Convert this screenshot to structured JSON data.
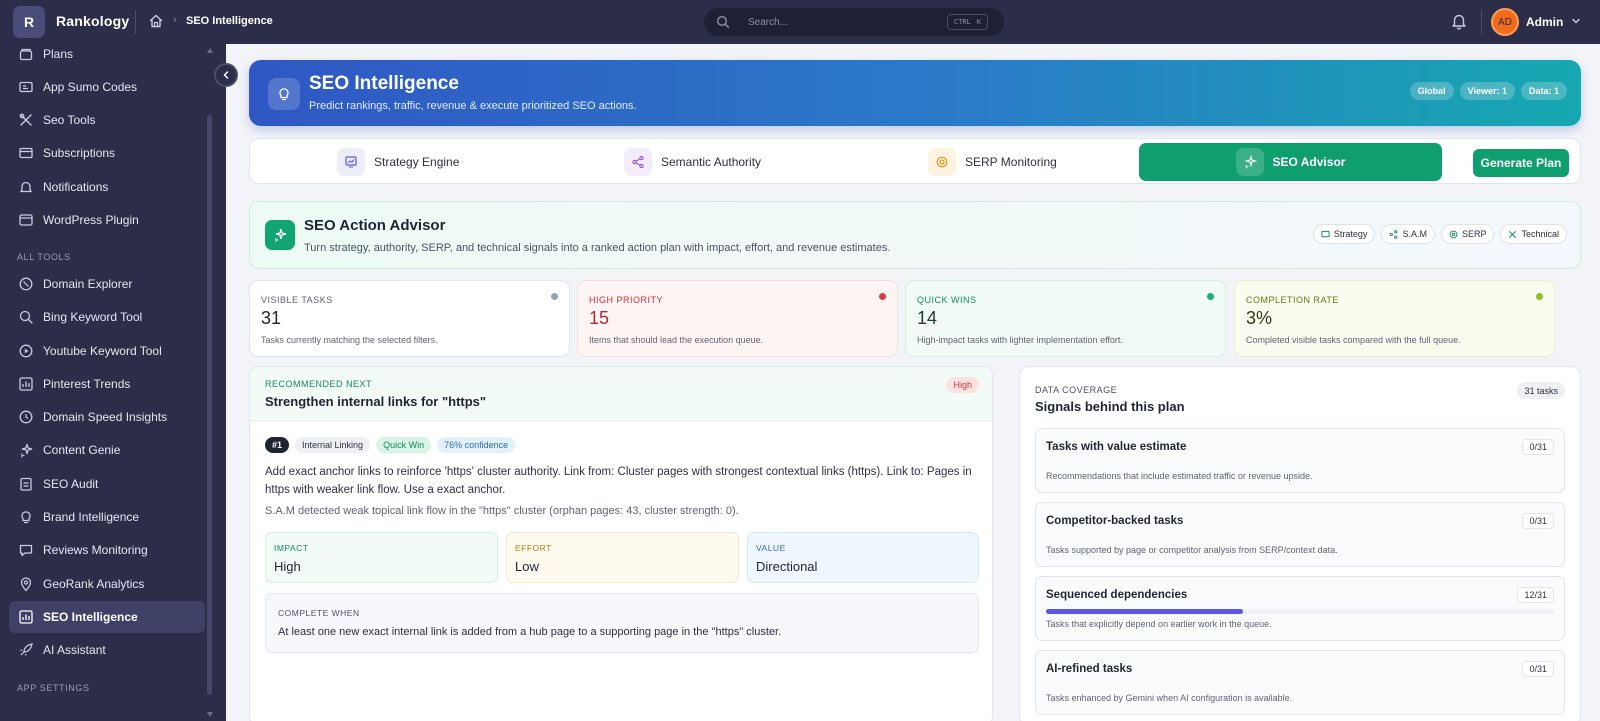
{
  "app": {
    "logo_letter": "R",
    "name": "Rankology"
  },
  "breadcrumb": {
    "current": "SEO Intelligence"
  },
  "search": {
    "placeholder": "Search...",
    "shortcut_ctrl": "CTRL",
    "shortcut_key": "K"
  },
  "user": {
    "initials": "AD",
    "name": "Admin"
  },
  "sidebar": {
    "items_top": [
      {
        "label": "Plans",
        "icon": "plans-icon"
      },
      {
        "label": "App Sumo Codes",
        "icon": "ticket-icon"
      },
      {
        "label": "Seo Tools",
        "icon": "tools-icon"
      },
      {
        "label": "Subscriptions",
        "icon": "card-icon"
      },
      {
        "label": "Notifications",
        "icon": "bell-icon"
      },
      {
        "label": "WordPress Plugin",
        "icon": "plugin-icon"
      }
    ],
    "section_tools": "ALL TOOLS",
    "items_tools": [
      {
        "label": "Domain Explorer",
        "icon": "globe-icon"
      },
      {
        "label": "Bing Keyword Tool",
        "icon": "search-icon"
      },
      {
        "label": "Youtube Keyword Tool",
        "icon": "play-icon"
      },
      {
        "label": "Pinterest Trends",
        "icon": "chart-icon"
      },
      {
        "label": "Domain Speed Insights",
        "icon": "clock-icon"
      },
      {
        "label": "Content Genie",
        "icon": "sparkle-icon"
      },
      {
        "label": "SEO Audit",
        "icon": "audit-icon"
      },
      {
        "label": "Brand Intelligence",
        "icon": "bulb-icon"
      },
      {
        "label": "Reviews Monitoring",
        "icon": "chat-icon"
      },
      {
        "label": "GeoRank Analytics",
        "icon": "pin-icon"
      },
      {
        "label": "SEO Intelligence",
        "icon": "chart-icon",
        "active": true
      },
      {
        "label": "AI Assistant",
        "icon": "rocket-icon"
      }
    ],
    "section_settings": "APP SETTINGS"
  },
  "hero": {
    "title": "SEO Intelligence",
    "subtitle": "Predict rankings, traffic, revenue & execute prioritized SEO actions.",
    "pills": [
      "Global",
      "Viewer: 1",
      "Data: 1"
    ]
  },
  "tabs": [
    {
      "label": "Strategy Engine"
    },
    {
      "label": "Semantic Authority"
    },
    {
      "label": "SERP Monitoring"
    },
    {
      "label": "SEO Advisor",
      "active": true
    }
  ],
  "generate_button": "Generate Plan",
  "advisor": {
    "title": "SEO Action Advisor",
    "subtitle": "Turn strategy, authority, SERP, and technical signals into a ranked action plan with impact, effort, and revenue estimates.",
    "chips": [
      "Strategy",
      "S.A.M",
      "SERP",
      "Technical"
    ]
  },
  "stats": [
    {
      "label": "VISIBLE TASKS",
      "value": "31",
      "desc": "Tasks currently matching the selected filters.",
      "color": "#5a6172",
      "dot": "#9aa0ad"
    },
    {
      "label": "HIGH PRIORITY",
      "value": "15",
      "desc": "Items that should lead the execution queue.",
      "color": "#c0303a",
      "dot": "#e03b3b"
    },
    {
      "label": "QUICK WINS",
      "value": "14",
      "desc": "High-impact tasks with lighter implementation effort.",
      "color": "#13895f",
      "dot": "#16b27a"
    },
    {
      "label": "COMPLETION RATE",
      "value": "3%",
      "desc": "Completed visible tasks compared with the full queue.",
      "color": "#5e7a13",
      "dot": "#8bc320"
    }
  ],
  "recommended": {
    "label": "RECOMMENDED NEXT",
    "title": "Strengthen internal links for \"https\"",
    "priority": "High",
    "tags": [
      "#1",
      "Internal Linking",
      "Quick Win",
      "76% confidence"
    ],
    "body": "Add exact anchor links to reinforce 'https' cluster authority. Link from: Cluster pages with strongest contextual links (https). Link to: Pages in https with weaker link flow. Use a exact anchor.",
    "note": "S.A.M detected weak topical link flow in the \"https\" cluster (orphan pages: 43, cluster strength: 0).",
    "impact_label": "IMPACT",
    "impact_value": "High",
    "effort_label": "EFFORT",
    "effort_value": "Low",
    "value_label": "VALUE",
    "value_value": "Directional",
    "complete_label": "COMPLETE WHEN",
    "complete_value": "At least one new exact internal link is added from a hub page to a supporting page in the \"https\" cluster."
  },
  "coverage": {
    "label": "DATA COVERAGE",
    "title": "Signals behind this plan",
    "badge": "31 tasks",
    "items": [
      {
        "title": "Tasks with value estimate",
        "count": "0/31",
        "desc": "Recommendations that include estimated traffic or revenue upside.",
        "progress": 0
      },
      {
        "title": "Competitor-backed tasks",
        "count": "0/31",
        "desc": "Tasks supported by page or competitor analysis from SERP/context data.",
        "progress": 0
      },
      {
        "title": "Sequenced dependencies",
        "count": "12/31",
        "desc": "Tasks that explicitly depend on earlier work in the queue.",
        "progress": 0.387
      },
      {
        "title": "AI-refined tasks",
        "count": "0/31",
        "desc": "Tasks enhanced by Gemini when AI configuration is available.",
        "progress": 0
      }
    ]
  }
}
